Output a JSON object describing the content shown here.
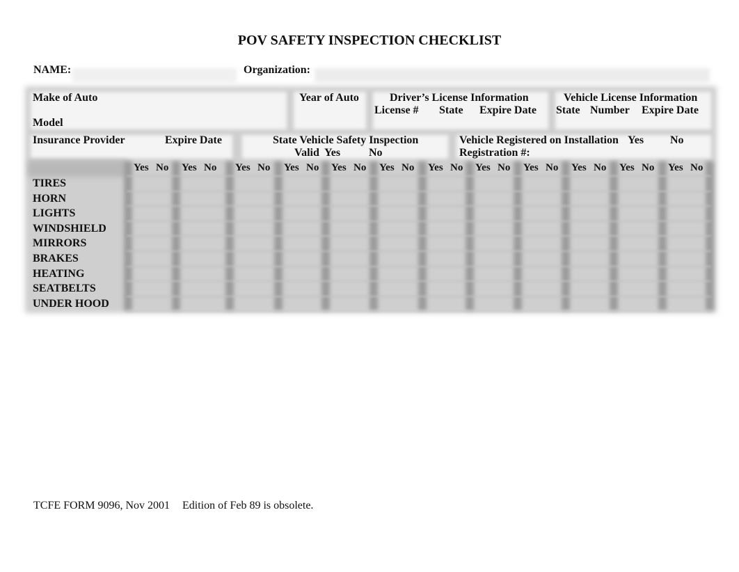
{
  "title": "POV SAFETY INSPECTION CHECKLIST",
  "header": {
    "name_label": "NAME:",
    "name_value": "",
    "organization_label": "Organization:",
    "organization_value": ""
  },
  "vehicle_info": {
    "make_label": "Make of Auto",
    "model_label": "Model",
    "year_label": "Year of Auto",
    "drivers_license": {
      "heading": "Driver’s License Information",
      "license_no_label": "License #",
      "state_label": "State",
      "expire_label": "Expire Date"
    },
    "vehicle_license": {
      "heading": "Vehicle License Information",
      "state_label": "State",
      "number_label": "Number",
      "expire_label": "Expire Date"
    },
    "insurance_label": "Insurance Provider",
    "insurance_expire_label": "Expire Date",
    "safety_inspection": {
      "heading": "State Vehicle Safety Inspection",
      "valid_label": "Valid",
      "yes_label": "Yes",
      "no_label": "No"
    },
    "registered": {
      "heading": "Vehicle Registered on Installation",
      "yes_label": "Yes",
      "no_label": "No",
      "registration_label": "Registration #:"
    }
  },
  "checklist": {
    "yes_label": "Yes",
    "no_label": "No",
    "column_count": 12,
    "items": [
      "TIRES",
      "HORN",
      "LIGHTS",
      "WINDSHIELD",
      "MIRRORS",
      "BRAKES",
      "HEATING",
      "SEATBELTS",
      "UNDER HOOD"
    ]
  },
  "footer": {
    "form_id": "TCFE FORM 9096, Nov 2001",
    "note": "Edition of Feb 89 is obsolete."
  }
}
